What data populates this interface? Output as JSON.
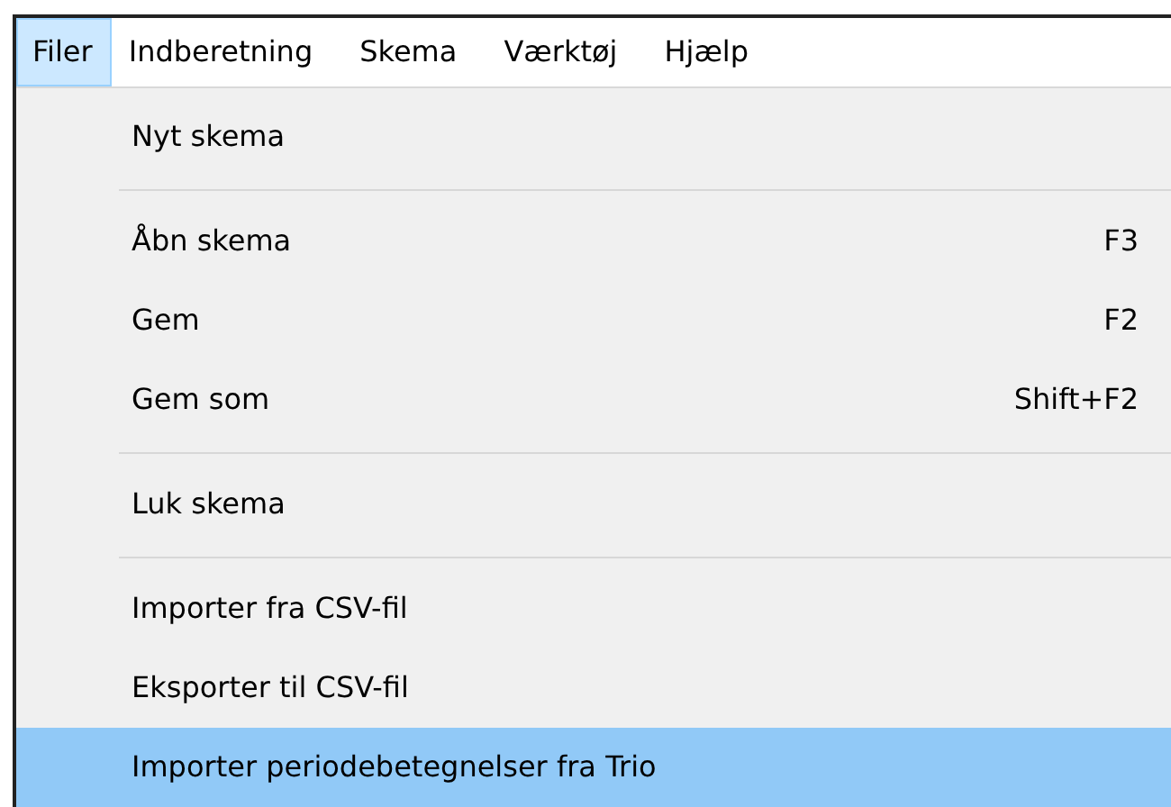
{
  "menubar": [
    {
      "label": "Filer",
      "selected": true
    },
    {
      "label": "Indberetning",
      "selected": false
    },
    {
      "label": "Skema",
      "selected": false
    },
    {
      "label": "Værktøj",
      "selected": false
    },
    {
      "label": "Hjælp",
      "selected": false
    }
  ],
  "menu": [
    {
      "kind": "item",
      "label": "Nyt skema",
      "selected": false
    },
    {
      "kind": "separator"
    },
    {
      "kind": "item",
      "label": "Åbn skema",
      "shortcut": "F3",
      "selected": false
    },
    {
      "kind": "item",
      "label": "Gem",
      "shortcut": "F2",
      "selected": false
    },
    {
      "kind": "item",
      "label": "Gem som",
      "shortcut": "Shift+F2",
      "selected": false
    },
    {
      "kind": "separator"
    },
    {
      "kind": "item",
      "label": "Luk skema",
      "selected": false
    },
    {
      "kind": "separator"
    },
    {
      "kind": "item",
      "label": "Importer fra CSV-fil",
      "selected": false
    },
    {
      "kind": "item",
      "label": "Eksporter til CSV-fil",
      "selected": false
    },
    {
      "kind": "item",
      "label": "Importer periodebetegnelser fra Trio",
      "selected": true
    }
  ]
}
